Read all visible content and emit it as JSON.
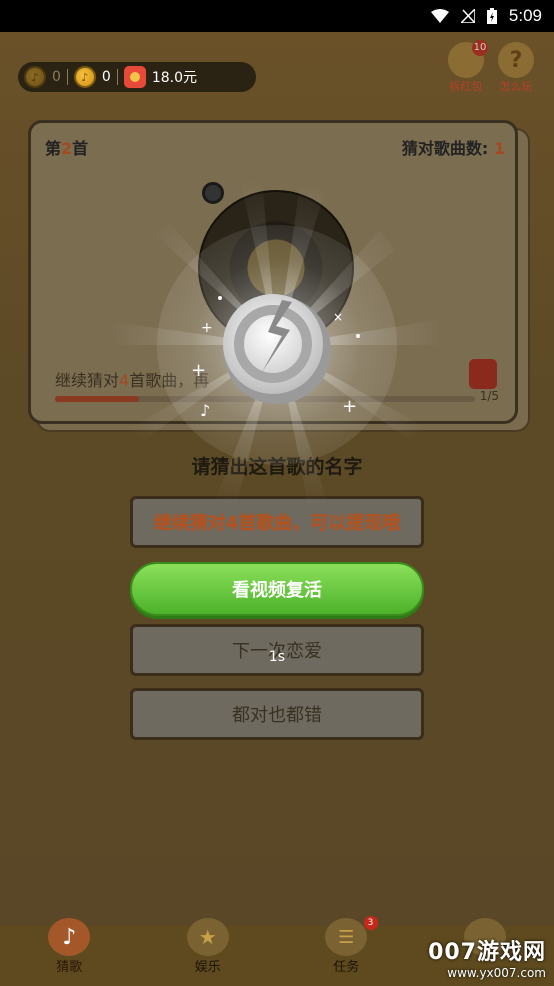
{
  "status_bar": {
    "time": "5:09"
  },
  "top_bar": {
    "coins_a": "0",
    "coins_b": "0",
    "cash": "18.0元"
  },
  "top_right": {
    "redpack_label": "拆红包",
    "redpack_badge": "10",
    "help_label": "怎么玩"
  },
  "card": {
    "song_prefix": "第",
    "song_number": "2",
    "song_suffix": "首",
    "guess_label": "猜对歌曲数:",
    "guess_count": "1",
    "progress_prefix": "继续猜对",
    "progress_num": "4",
    "progress_suffix": "首歌曲，再",
    "progress_count": "1/5",
    "progress_fraction": 0.2
  },
  "question": "请猜出这首歌的名字",
  "options": {
    "first": "继续猜对4首歌曲，可以提现哦",
    "revive": "看视频复活",
    "third": "下一次恋爱",
    "fourth": "都对也都错"
  },
  "countdown": "1s",
  "bottom_nav": {
    "items": [
      {
        "label": "猜歌"
      },
      {
        "label": "娱乐"
      },
      {
        "label": "任务",
        "badge": "3"
      },
      {
        "label": ""
      }
    ]
  },
  "watermark": {
    "big": "007游戏网",
    "small": "www.yx007.com"
  }
}
